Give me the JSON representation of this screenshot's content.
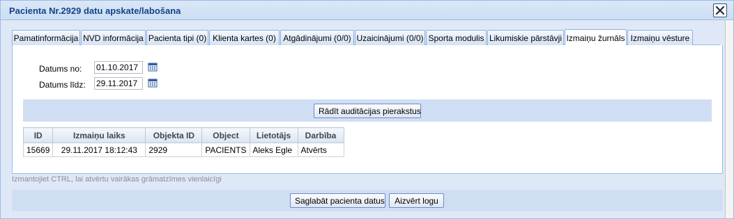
{
  "window": {
    "title": "Pacienta Nr.2929 datu apskate/labošana"
  },
  "tabs": [
    {
      "label": "Pamatinformācija",
      "active": false
    },
    {
      "label": "NVD informācija",
      "active": false
    },
    {
      "label": "Pacienta tipi (0)",
      "active": false
    },
    {
      "label": "Klienta kartes (0)",
      "active": false
    },
    {
      "label": "Atgādinājumi (0/0)",
      "active": false
    },
    {
      "label": "Uzaicinājumi (0/0)",
      "active": false
    },
    {
      "label": "Sporta modulis",
      "active": false
    },
    {
      "label": "Likumiskie pārstāvji",
      "active": false
    },
    {
      "label": "Izmaiņu žurnāls",
      "active": true
    },
    {
      "label": "Izmaiņu vēsture",
      "active": false
    }
  ],
  "filters": {
    "date_from_label": "Datums no:",
    "date_from_value": "01.10.2017",
    "date_to_label": "Datums līdz:",
    "date_to_value": "29.11.2017",
    "calendar_icon": "calendar-icon"
  },
  "show_audit_button": "Rādīt auditācijas pierakstus",
  "table": {
    "columns": [
      "ID",
      "Izmaiņu laiks",
      "Objekta ID",
      "Object",
      "Lietotājs",
      "Darbība"
    ],
    "rows": [
      [
        "15669",
        "29.11.2017 18:12:43",
        "2929",
        "PACIENTS",
        "Aleks Egle",
        "Atvērts"
      ]
    ]
  },
  "hint": "Izmantojiet CTRL, lai atvērtu vairākas grāmatzīmes vienlaicīgi",
  "footer": {
    "save_label": "Saglabāt pacienta datus",
    "close_label": "Aizvērt logu"
  },
  "colors": {
    "title_text": "#15428b",
    "window_bg": "#dfe8f6",
    "border": "#99bbe8",
    "toolbar_bg": "#d0def4"
  }
}
